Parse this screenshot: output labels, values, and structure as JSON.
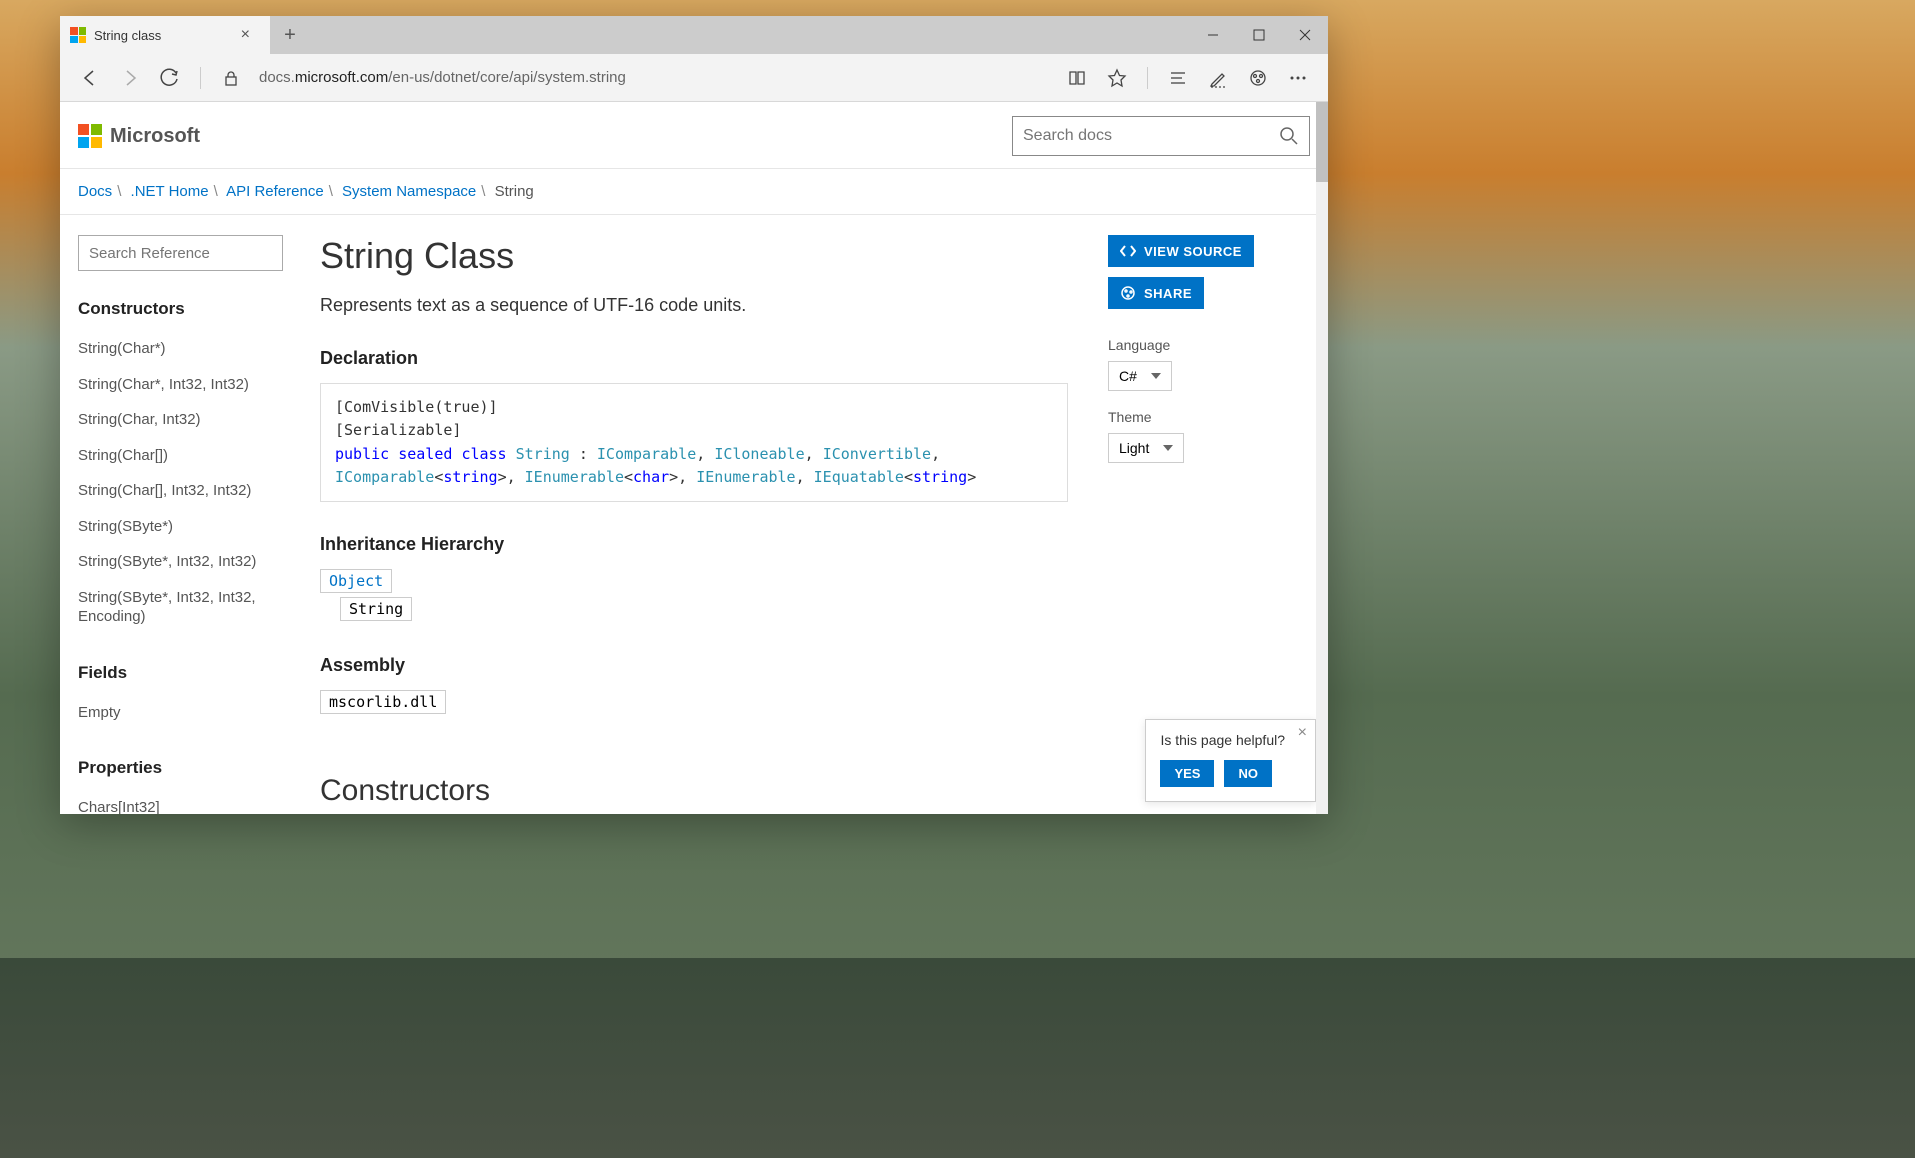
{
  "browser": {
    "tab_title": "String class",
    "url_prefix": "docs.",
    "url_domain": "microsoft.com",
    "url_path": "/en-us/dotnet/core/api/system.string"
  },
  "header": {
    "brand": "Microsoft",
    "search_placeholder": "Search docs"
  },
  "breadcrumb": {
    "items": [
      "Docs",
      ".NET Home",
      "API Reference",
      "System Namespace"
    ],
    "current": "String"
  },
  "sidebar": {
    "search_placeholder": "Search Reference",
    "sections": [
      {
        "title": "Constructors",
        "items": [
          "String(Char*)",
          "String(Char*, Int32, Int32)",
          "String(Char, Int32)",
          "String(Char[])",
          "String(Char[], Int32, Int32)",
          "String(SByte*)",
          "String(SByte*, Int32, Int32)",
          "String(SByte*, Int32, Int32, Encoding)"
        ]
      },
      {
        "title": "Fields",
        "items": [
          "Empty"
        ]
      },
      {
        "title": "Properties",
        "items": [
          "Chars[Int32]"
        ]
      }
    ]
  },
  "article": {
    "title": "String Class",
    "description": "Represents text as a sequence of UTF-16 code units.",
    "declaration_heading": "Declaration",
    "declaration_code": {
      "line1": "[ComVisible(true)]",
      "line2": "[Serializable]",
      "tokens": [
        {
          "t": "public",
          "c": "kw"
        },
        {
          "t": " "
        },
        {
          "t": "sealed",
          "c": "kw"
        },
        {
          "t": " "
        },
        {
          "t": "class",
          "c": "kw"
        },
        {
          "t": " "
        },
        {
          "t": "String",
          "c": "typ"
        },
        {
          "t": " : "
        },
        {
          "t": "IComparable",
          "c": "typ"
        },
        {
          "t": ", "
        },
        {
          "t": "ICloneable",
          "c": "typ"
        },
        {
          "t": ", "
        },
        {
          "t": "IConvertible",
          "c": "typ"
        },
        {
          "t": ", "
        },
        {
          "t": "IComparable",
          "c": "typ"
        },
        {
          "t": "<"
        },
        {
          "t": "string",
          "c": "kw"
        },
        {
          "t": ">, "
        },
        {
          "t": "IEnumerable",
          "c": "typ"
        },
        {
          "t": "<"
        },
        {
          "t": "char",
          "c": "kw"
        },
        {
          "t": ">, "
        },
        {
          "t": "IEnumerable",
          "c": "typ"
        },
        {
          "t": ", "
        },
        {
          "t": "IEquatable",
          "c": "typ"
        },
        {
          "t": "<"
        },
        {
          "t": "string",
          "c": "kw"
        },
        {
          "t": ">"
        }
      ]
    },
    "hierarchy_heading": "Inheritance Hierarchy",
    "hierarchy": {
      "base": "Object",
      "derived": "String"
    },
    "assembly_heading": "Assembly",
    "assembly": "mscorlib.dll",
    "constructors_heading": "Constructors"
  },
  "actions": {
    "view_source": "VIEW SOURCE",
    "share": "SHARE",
    "language_label": "Language",
    "language_value": "C#",
    "theme_label": "Theme",
    "theme_value": "Light"
  },
  "feedback": {
    "question": "Is this page helpful?",
    "yes": "YES",
    "no": "NO"
  }
}
